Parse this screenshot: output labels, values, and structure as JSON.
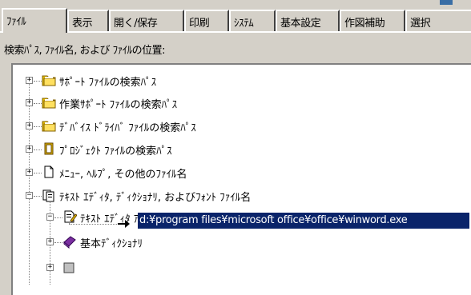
{
  "tabs": [
    "ﾌｧｲﾙ",
    "表示",
    "開く/保存",
    "印刷",
    "ｼｽﾃﾑ",
    "基本設定",
    "作図補助",
    "選択"
  ],
  "section_label": "検索ﾊﾟｽ, ﾌｧｲﾙ名, および ﾌｧｲﾙの位置:",
  "tree": [
    {
      "label": "ｻﾎﾟｰﾄ ﾌｧｲﾙの検索ﾊﾟｽ",
      "icon": "folder-stack-icon",
      "expander": "+"
    },
    {
      "label": "作業ｻﾎﾟｰﾄ ﾌｧｲﾙの検索ﾊﾟｽ",
      "icon": "folder-stack-icon",
      "expander": "+"
    },
    {
      "label": "ﾃﾞﾊﾞｲｽ ﾄﾞﾗｲﾊﾞ ﾌｧｲﾙの検索ﾊﾟｽ",
      "icon": "folder-stack-icon",
      "expander": "+"
    },
    {
      "label": "ﾌﾟﾛｼﾞｪｸﾄ ﾌｧｲﾙの検索ﾊﾟｽ",
      "icon": "project-file-icon",
      "expander": "+"
    },
    {
      "label": "ﾒﾆｭｰ, ﾍﾙﾌﾟ, その他のﾌｧｲﾙ名",
      "icon": "document-icon",
      "expander": "+"
    },
    {
      "label": "ﾃｷｽﾄ ｴﾃﾞｨﾀ, ﾃﾞｨｸｼｮﾅﾘ, およびﾌｫﾝﾄ ﾌｧｲﾙ名",
      "icon": "documents-icon",
      "expander": "−"
    },
    {
      "label": "ﾃｷｽﾄ ｴﾃﾞｨﾀ ｱﾌﾟﾘｹｰｼｮﾝ",
      "icon": "text-editor-icon",
      "expander": "−"
    },
    {
      "label": "d:¥program files¥microsoft office¥office¥winword.exe",
      "icon": "arrow-icon",
      "selected": true
    },
    {
      "label": "基本ﾃﾞｨｸｼｮﾅﾘ",
      "icon": "book-icon",
      "expander": "+"
    }
  ]
}
